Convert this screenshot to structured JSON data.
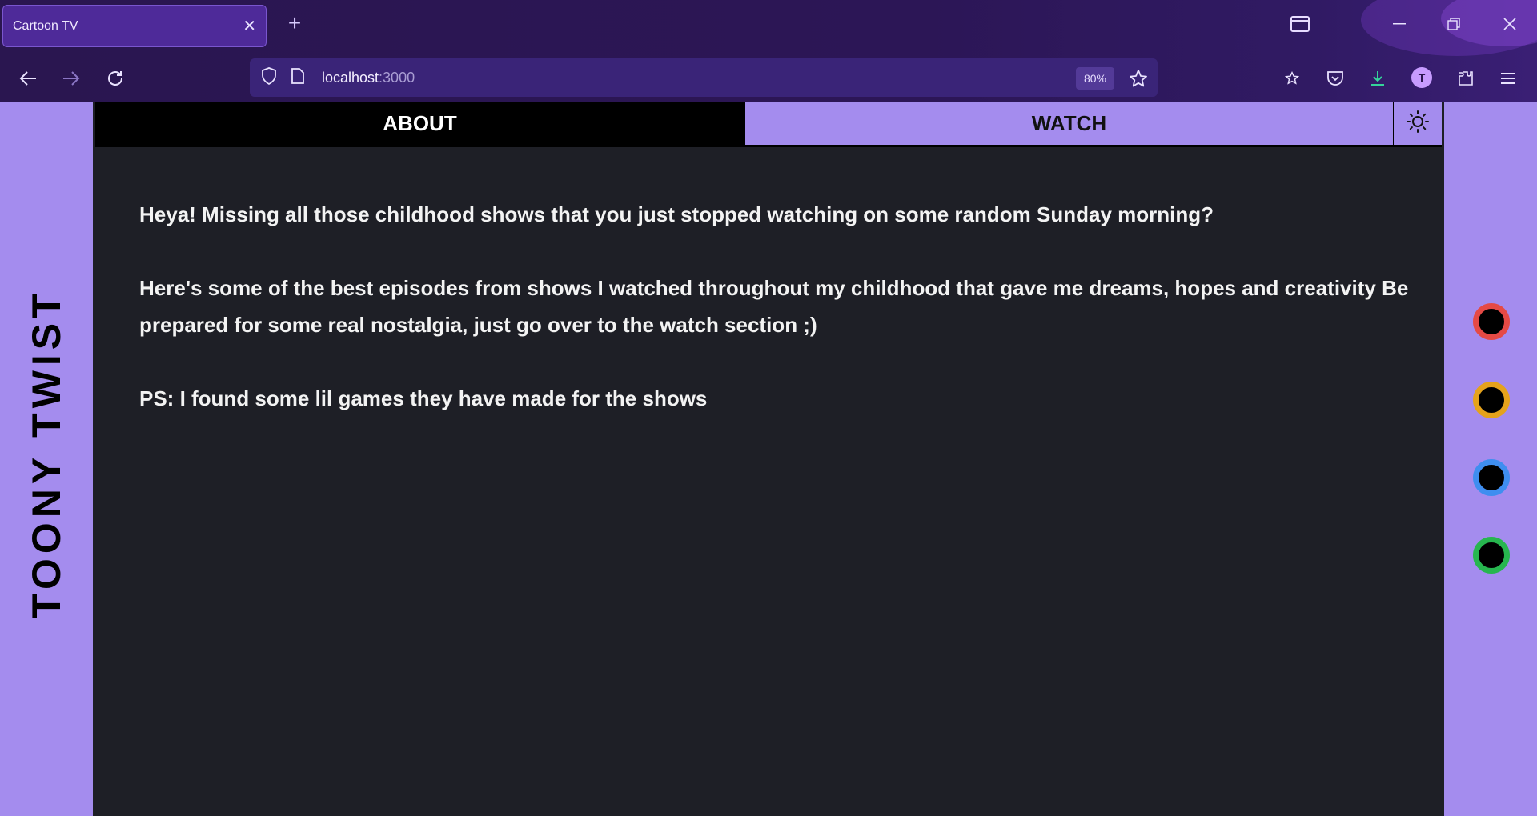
{
  "browser": {
    "tab_title": "Cartoon TV",
    "tab_close": "✕",
    "new_tab": "+",
    "url_host": "localhost",
    "url_port": ":3000",
    "zoom": "80%",
    "avatar_letter": "T"
  },
  "site": {
    "brand": "TOONY TWIST",
    "nav": {
      "about": "ABOUT",
      "watch": "WATCH"
    },
    "paragraphs": [
      "Heya! Missing all those childhood shows that you just stopped watching on some random Sunday morning?",
      "Here's some of the best episodes from shows I watched throughout my childhood that gave me dreams, hopes and creativity Be prepared for some real nostalgia, just go over to the watch section ;)",
      "PS: I found some lil games they have made for the shows"
    ],
    "theme_dots": [
      {
        "name": "red",
        "color": "#e54a45"
      },
      {
        "name": "yellow",
        "color": "#e5a21b"
      },
      {
        "name": "blue",
        "color": "#3f8ef0"
      },
      {
        "name": "green",
        "color": "#27b64f"
      }
    ]
  }
}
